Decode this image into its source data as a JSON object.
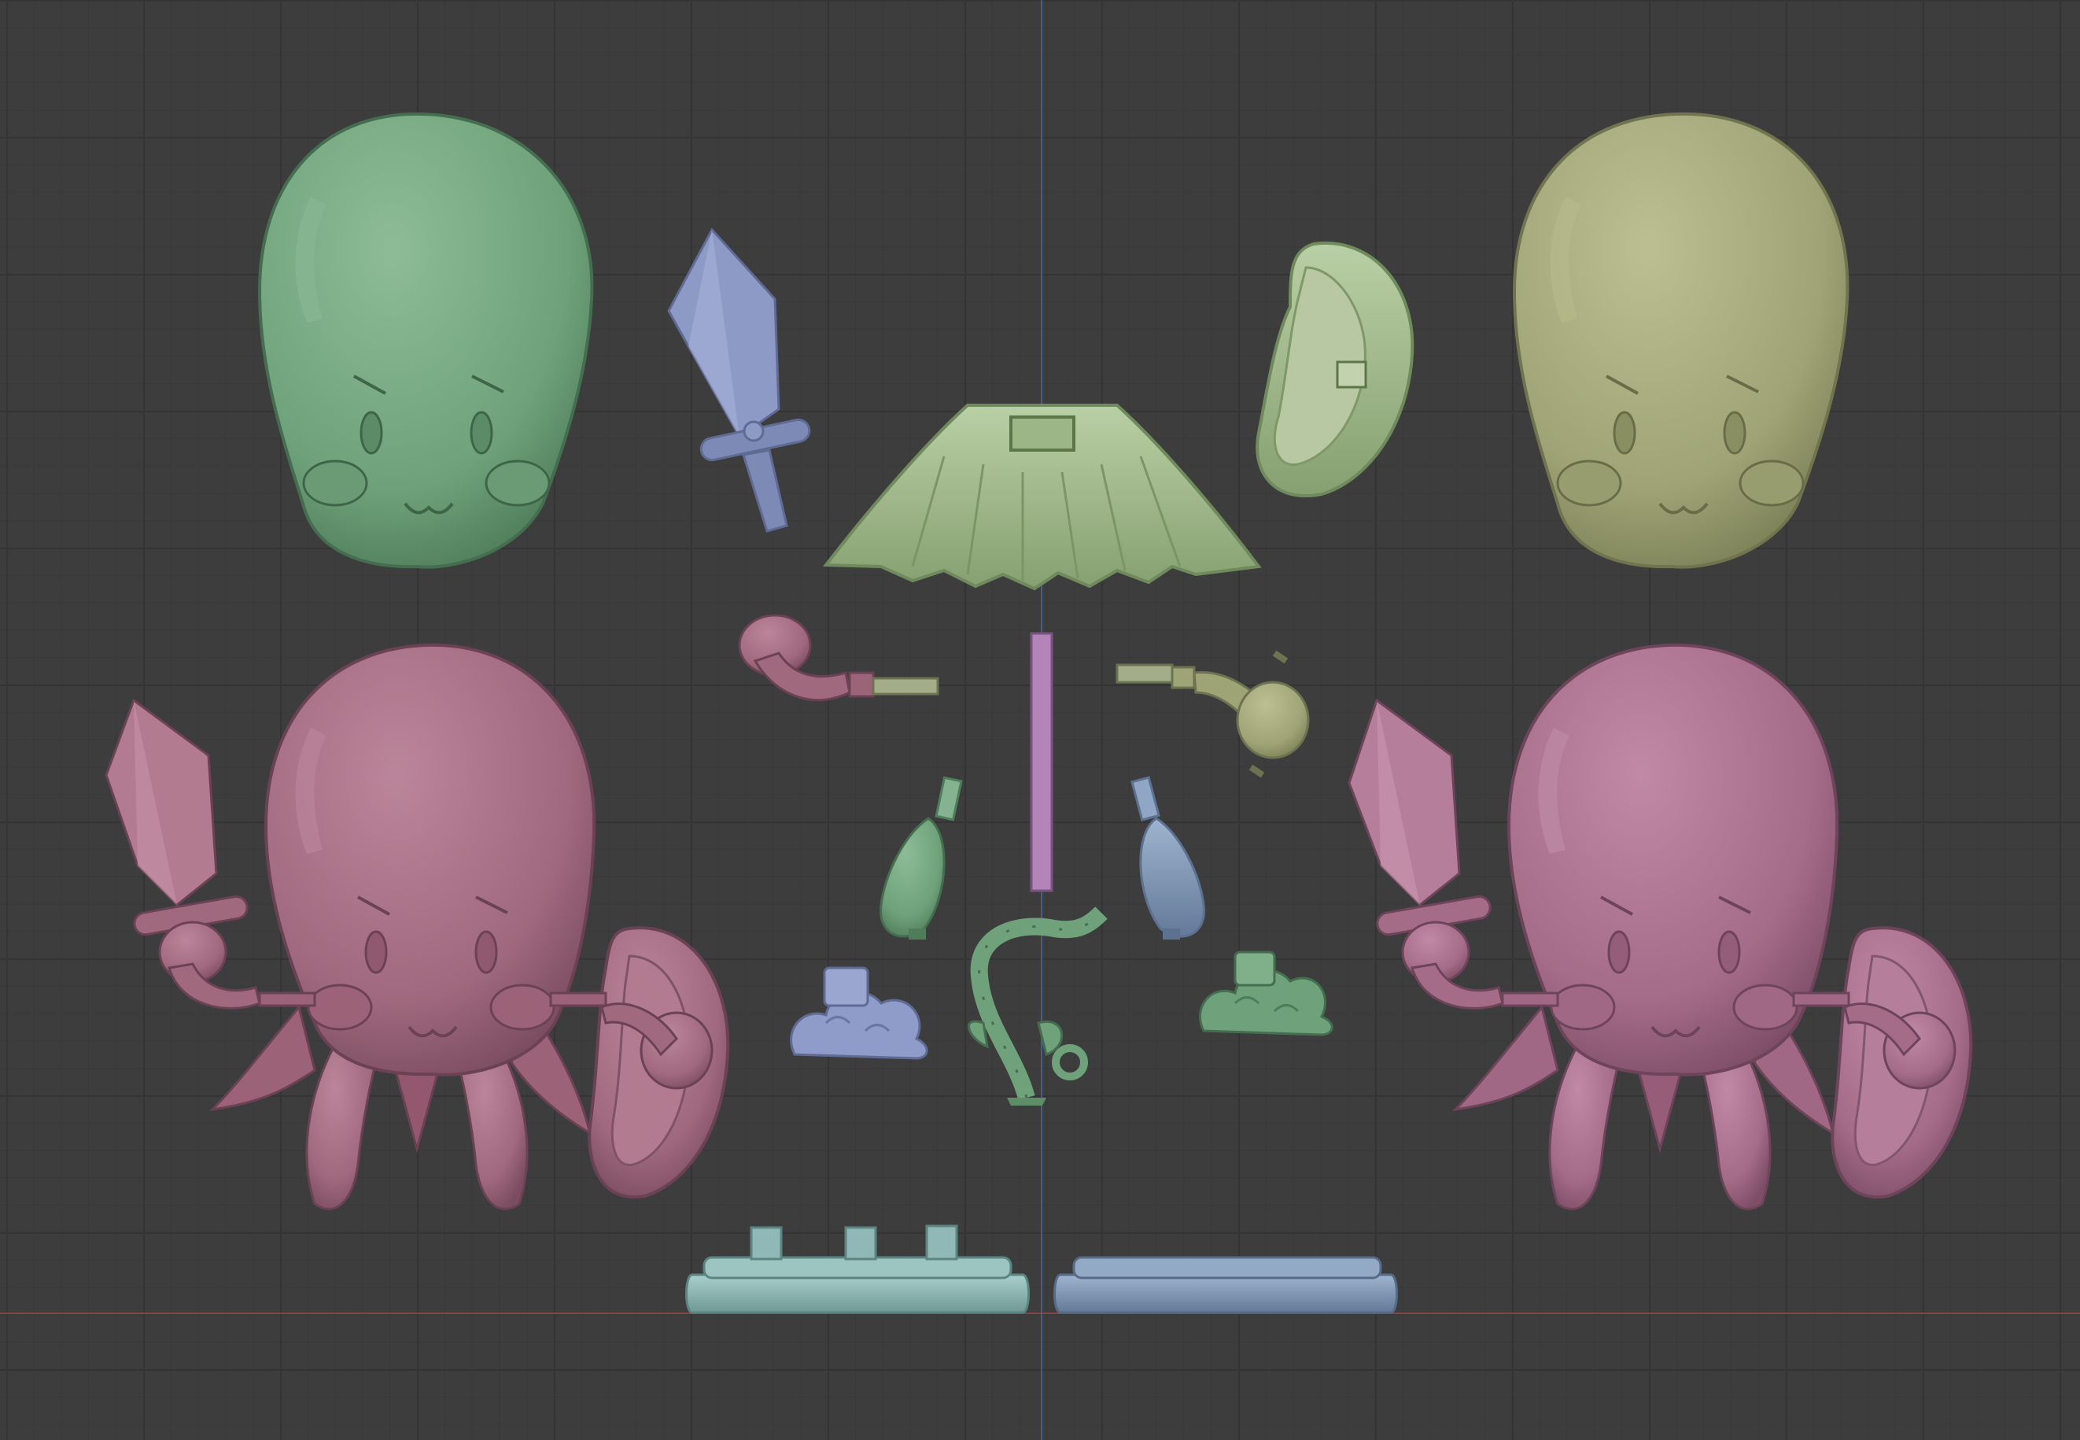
{
  "scene": {
    "background": "#3d3d3d",
    "grid_major": "#343434",
    "grid_minor": "#393939",
    "axis_y_color": "#4b6aa0",
    "axis_x_color": "#9a4a4a",
    "palette": {
      "green": "#6fa27a",
      "olive": "#9fa476",
      "pale-green": "#a7bf93",
      "mauve": "#a0697e",
      "mauve-light": "#a56c88",
      "blue-gray": "#8693bd",
      "slate-blue": "#7a8fb0",
      "teal": "#8fb8b6",
      "lavender": "#b384b8"
    },
    "objects": [
      {
        "name": "head-green",
        "color": "green"
      },
      {
        "name": "head-olive",
        "color": "olive"
      },
      {
        "name": "sword",
        "color": "blue-gray"
      },
      {
        "name": "cape-skirt",
        "color": "pale-green"
      },
      {
        "name": "ear-shield",
        "color": "pale-green"
      },
      {
        "name": "left-arm",
        "color": "mauve"
      },
      {
        "name": "right-arm",
        "color": "olive"
      },
      {
        "name": "support-rod",
        "color": "lavender"
      },
      {
        "name": "left-leg",
        "color": "green"
      },
      {
        "name": "right-leg",
        "color": "slate-blue"
      },
      {
        "name": "cloud-left",
        "color": "blue-gray"
      },
      {
        "name": "cloud-right",
        "color": "green"
      },
      {
        "name": "vine-plant",
        "color": "green"
      },
      {
        "name": "base-left",
        "color": "teal"
      },
      {
        "name": "base-right",
        "color": "slate-blue"
      },
      {
        "name": "octopus-assembled-left",
        "color": "mauve"
      },
      {
        "name": "octopus-assembled-right",
        "color": "mauve-light"
      }
    ]
  }
}
